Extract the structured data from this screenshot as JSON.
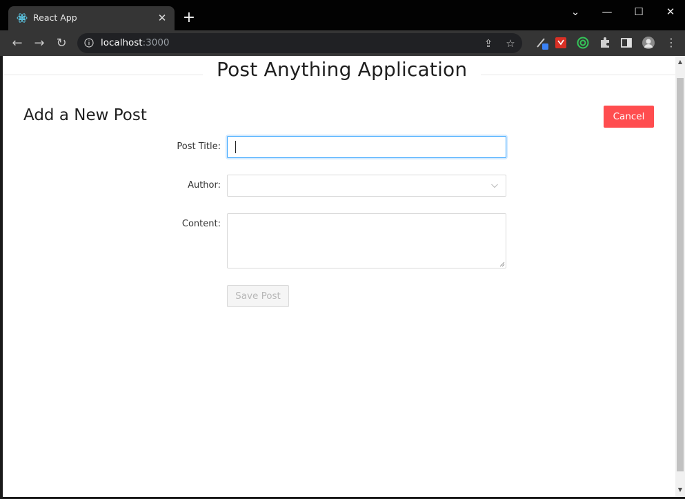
{
  "browser": {
    "tab_title": "React App",
    "tab_close": "✕",
    "new_tab": "+",
    "url_host": "localhost",
    "url_port": ":3000",
    "window_controls": {
      "minimize": "—",
      "maximize": "☐",
      "close": "✕",
      "tab_search": "⌄"
    }
  },
  "page": {
    "app_title": "Post Anything Application",
    "form_title": "Add a New Post",
    "cancel_label": "Cancel",
    "fields": {
      "title_label": "Post Title",
      "title_value": "",
      "author_label": "Author",
      "author_value": "",
      "content_label": "Content",
      "content_value": ""
    },
    "save_label": "Save Post"
  },
  "colors": {
    "accent_blue": "#40a9ff",
    "cancel_red": "#ff4d4f",
    "disabled_bg": "#f5f5f5"
  }
}
